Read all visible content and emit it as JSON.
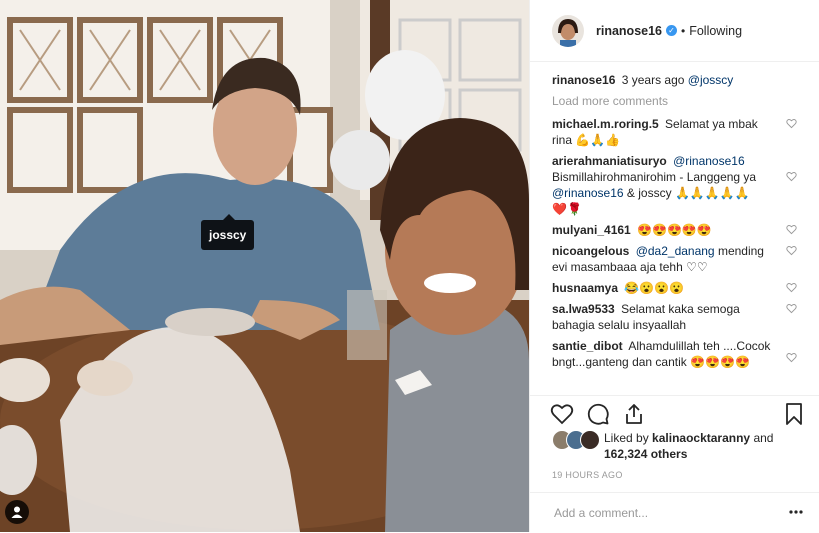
{
  "post": {
    "username": "rinanose16",
    "follow_status": "Following",
    "dot": "•",
    "caption": {
      "username": "rinanose16",
      "time": "3 years ago",
      "mention": "@josscy"
    },
    "load_more": "Load more comments",
    "comments": [
      {
        "user": "michael.m.roring.5",
        "text": "Selamat ya mbak rina",
        "emojis": [
          "💪",
          "🙏",
          "👍"
        ]
      },
      {
        "user": "arierahmaniatisuryo",
        "mention": "@rinanose16",
        "text": "Bismillahirohmanirohim - Langgeng ya",
        "mention2": "@rinanose16",
        "text2": "& josscy",
        "emojis": [
          "🙏",
          "🙏",
          "🙏",
          "🙏",
          "🙏"
        ],
        "emojis2": [
          "❤️",
          "🌹"
        ]
      },
      {
        "user": "mulyani_4161",
        "text": "",
        "emojis": [
          "😍",
          "😍",
          "😍",
          "😍",
          "😍"
        ]
      },
      {
        "user": "nicoangelous",
        "mention": "@da2_danang",
        "text": "mending evi masambaaa aja tehh ♡♡"
      },
      {
        "user": "husnaamya",
        "text": "",
        "emojis": [
          "😂",
          "😮",
          "😮",
          "😮"
        ]
      },
      {
        "user": "sa.lwa9533",
        "text": "Selamat kaka semoga bahagia selalu insyaallah"
      },
      {
        "user": "santie_dibot",
        "text": "Alhamdulillah teh ....Cocok bngt...ganteng dan cantik",
        "emojis": [
          "😍",
          "😍",
          "😍",
          "😍"
        ]
      }
    ],
    "likes": {
      "prefix": "Liked by",
      "user": "kalinaocktaranny",
      "and": "and",
      "count": "162,324 others"
    },
    "timestamp": "19 HOURS AGO",
    "add_comment_placeholder": "Add a comment...",
    "photo_tag": "josscy"
  }
}
